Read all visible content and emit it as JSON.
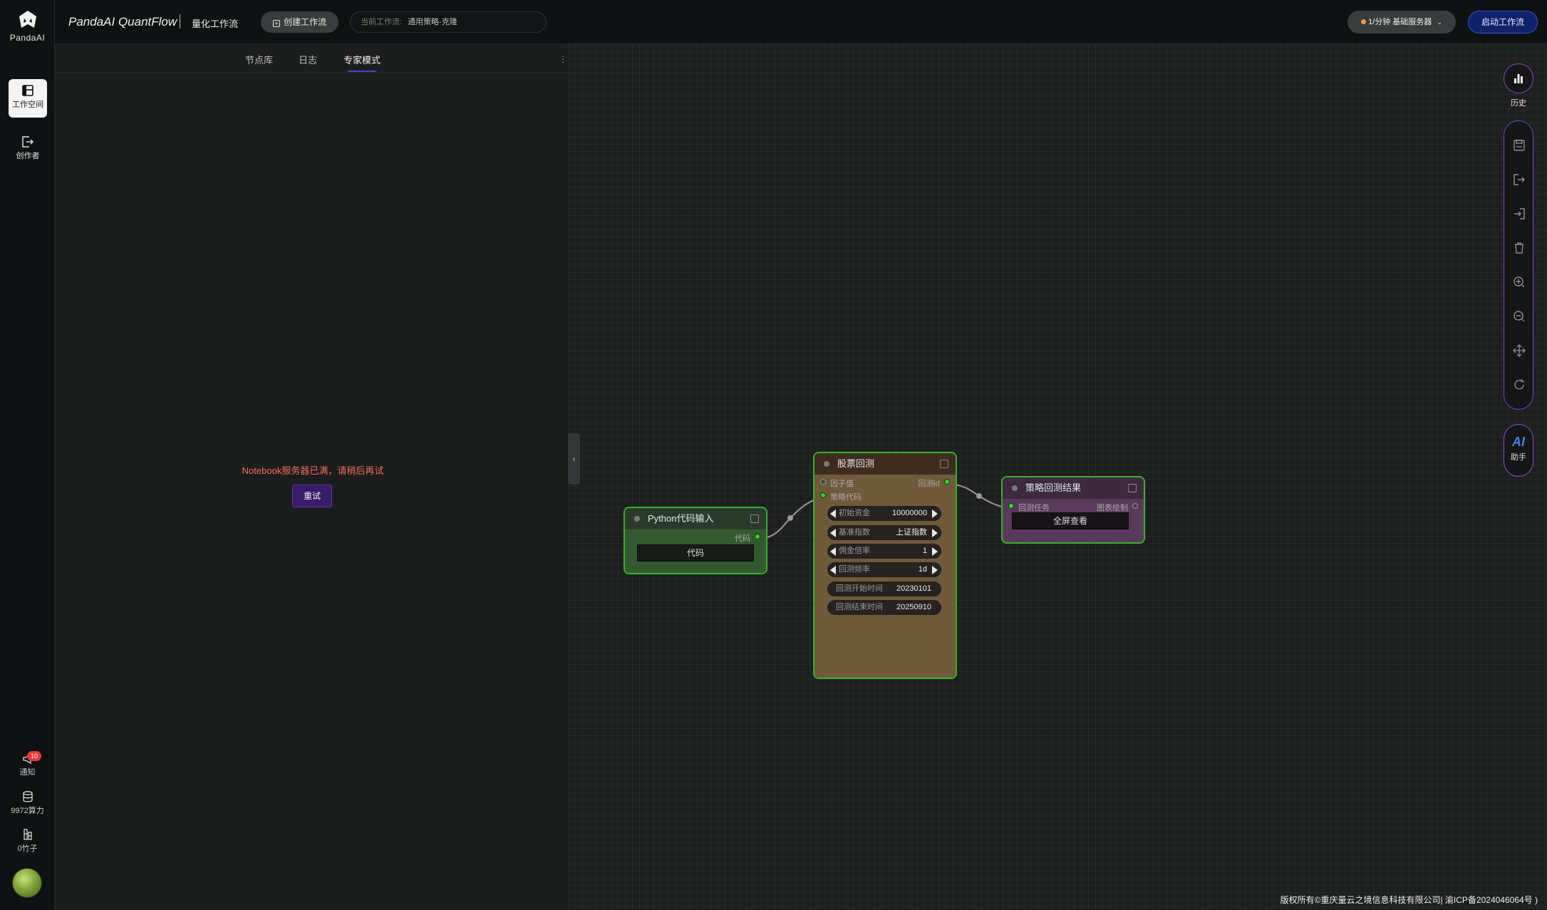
{
  "brand": {
    "logo_text": "PandaAI",
    "title": "PandaAI QuantFlow",
    "subtitle": "量化工作流"
  },
  "header": {
    "create_label": "创建工作流",
    "current_flow_key": "当前工作流:",
    "current_flow_value": "通用策略-克隆",
    "server_label": "1/分钟  基础服务器",
    "start_label": "启动工作流"
  },
  "rail": {
    "workspace": "工作空间",
    "creator": "创作者",
    "notify": "通知",
    "notify_count": "10",
    "compute": "9972算力",
    "bamboo": "0竹子"
  },
  "panel": {
    "tabs": [
      "节点库",
      "日志",
      "专家模式"
    ],
    "active_tab": "专家模式",
    "error": "Notebook服务器已满，请稍后再试",
    "retry": "重试"
  },
  "nodes": {
    "python": {
      "title": "Python代码输入",
      "out": "代码",
      "button": "代码"
    },
    "backtest": {
      "title": "股票回测",
      "in1": "因子值",
      "in2": "策略代码",
      "out": "回测id",
      "params": [
        {
          "k": "初始资金",
          "v": "10000000"
        },
        {
          "k": "基准指数",
          "v": "上证指数"
        },
        {
          "k": "佣金倍率",
          "v": "1"
        },
        {
          "k": "回测频率",
          "v": "1d"
        },
        {
          "k": "回测开始时间",
          "v": "20230101"
        },
        {
          "k": "回测结束时间",
          "v": "20250910"
        }
      ]
    },
    "result": {
      "title": "策略回测结果",
      "in": "回测任务",
      "out": "图表绘制",
      "button": "全屏查看"
    }
  },
  "right_toolbar": {
    "history": "历史",
    "assistant_mark": "AI",
    "assistant": "助手",
    "icons": [
      "save-icon",
      "export-icon",
      "import-icon",
      "delete-icon",
      "zoom-in-icon",
      "zoom-out-icon",
      "fit-view-icon",
      "refresh-icon"
    ]
  },
  "footer": "版权所有©重庆量云之境信息科技有限公司| 渝ICP备2024046064号 )",
  "colors": {
    "node_border": "#35b02a",
    "accent": "#4b3bd9",
    "error": "#f26d5b",
    "start_button": "#10226a"
  }
}
